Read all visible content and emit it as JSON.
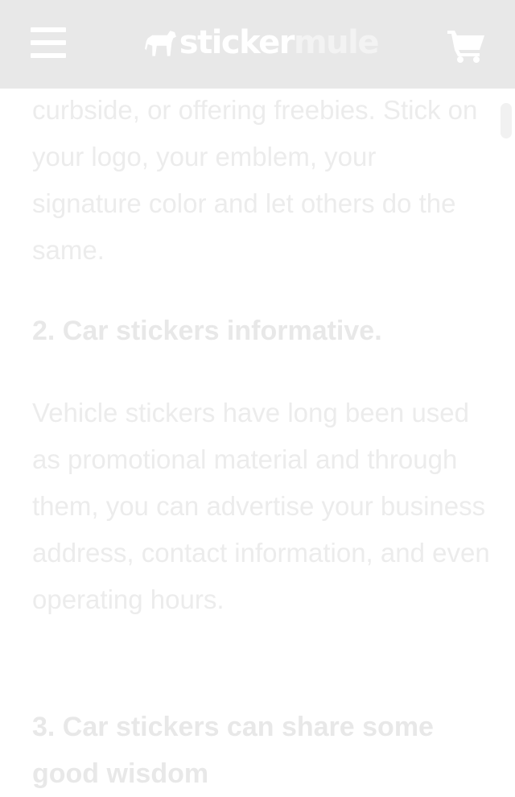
{
  "header": {
    "menu_icon": "hamburger-menu-icon",
    "logo_icon": "mule-icon",
    "logo": {
      "part1": "sticker",
      "part2": "mule"
    },
    "cart_icon": "shopping-cart-icon"
  },
  "article": {
    "paragraph1": "curbside, or offering freebies. Stick on your logo, your emblem, your signature color and let others do the same.",
    "heading2": "2. Car stickers informative.",
    "paragraph2": "Vehicle stickers have long been used as promotional material and through them, you can advertise your business address, contact information, and even operating hours.",
    "heading3": "3. Car stickers can share some good wisdom"
  },
  "colors": {
    "header_bg": "#e8e8e8",
    "text": "#ececec",
    "icon": "#ffffff"
  }
}
